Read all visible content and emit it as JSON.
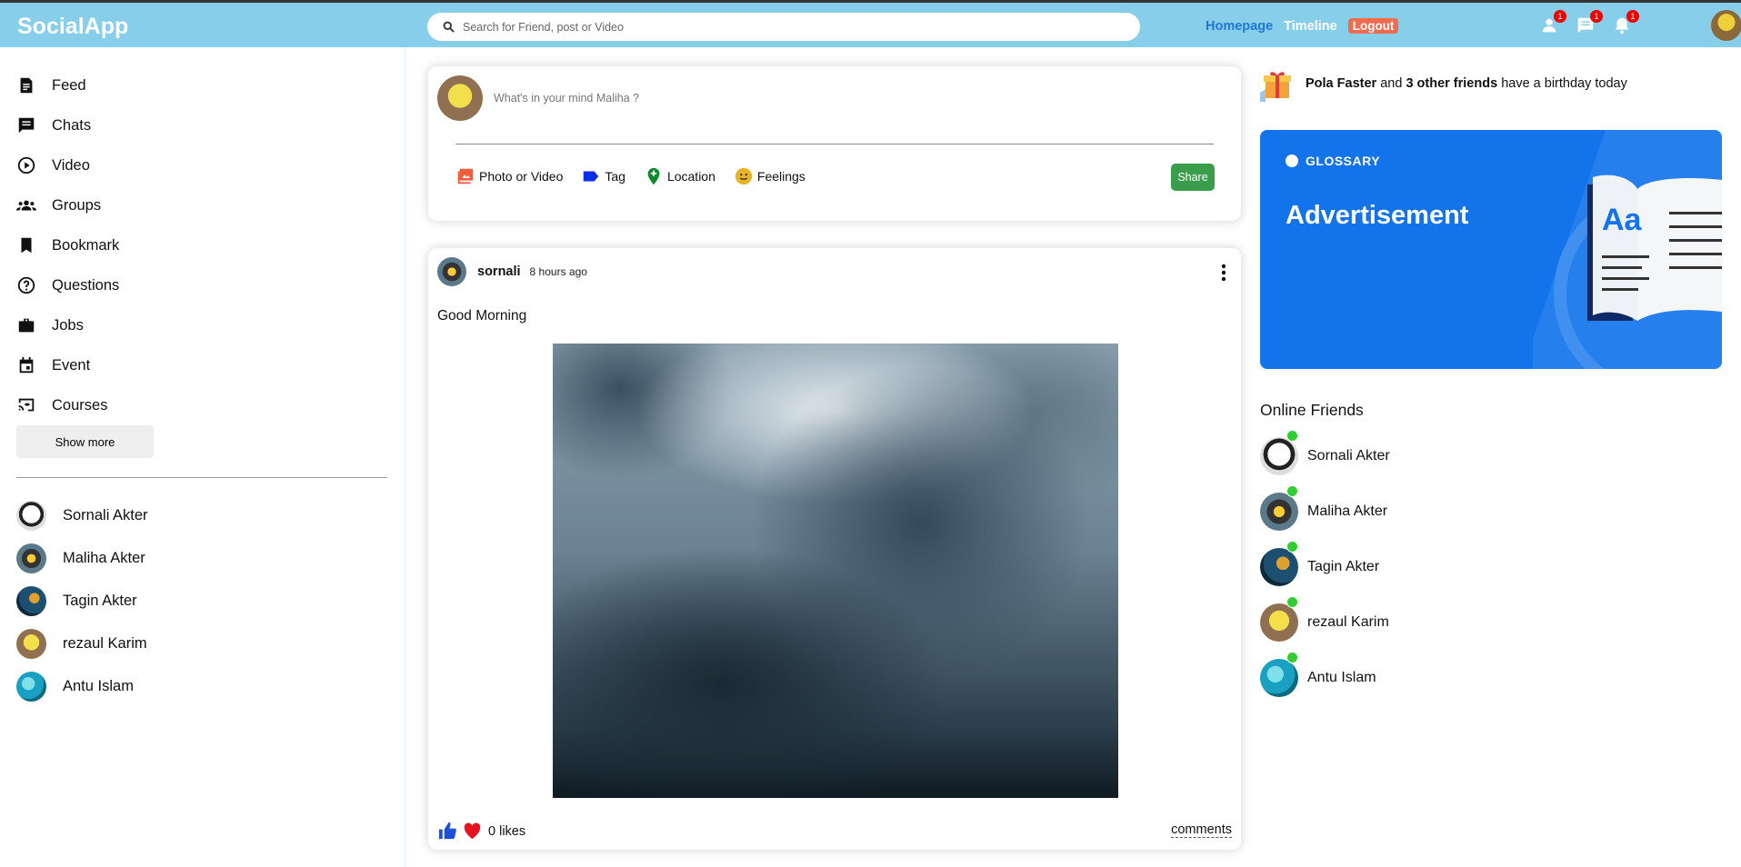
{
  "app": {
    "logo": "SocialApp"
  },
  "search": {
    "placeholder": "Search for Friend, post or Video"
  },
  "top_links": {
    "homepage": "Homepage",
    "timeline": "Timeline",
    "logout": "Logout"
  },
  "notifications": {
    "friends_count": "1",
    "messages_count": "1",
    "alerts_count": "1"
  },
  "sidebar": {
    "items": [
      {
        "label": "Feed",
        "icon": "feed-icon"
      },
      {
        "label": "Chats",
        "icon": "chat-icon"
      },
      {
        "label": "Video",
        "icon": "play-circle-icon"
      },
      {
        "label": "Groups",
        "icon": "groups-icon"
      },
      {
        "label": "Bookmark",
        "icon": "bookmark-icon"
      },
      {
        "label": "Questions",
        "icon": "help-circle-icon"
      },
      {
        "label": "Jobs",
        "icon": "briefcase-icon"
      },
      {
        "label": "Event",
        "icon": "calendar-icon"
      },
      {
        "label": "Courses",
        "icon": "cast-for-education-icon"
      }
    ],
    "show_more": "Show more",
    "friends": [
      "Sornali Akter",
      "Maliha Akter",
      "Tagin Akter",
      "rezaul Karim",
      "Antu Islam"
    ]
  },
  "composer": {
    "placeholder": "What's in your mind Maliha ?",
    "options": {
      "photo": "Photo or Video",
      "tag": "Tag",
      "location": "Location",
      "feelings": "Feelings"
    },
    "share": "Share"
  },
  "post": {
    "username": "sornali",
    "time": "8 hours ago",
    "text": "Good Morning",
    "likes": "0 likes",
    "comments": "comments"
  },
  "birthday": {
    "name": "Pola Faster",
    "others": "3 other friends",
    "suffix": "have a birthday today",
    "and": "and"
  },
  "ad": {
    "brand": "GLOSSARY",
    "title": "Advertisement",
    "book_text": "Aa"
  },
  "online": {
    "title": "Online Friends",
    "friends": [
      "Sornali Akter",
      "Maliha Akter",
      "Tagin Akter",
      "rezaul Karim",
      "Antu Islam"
    ]
  },
  "colors": {
    "topbar": "#87ceeb",
    "active_link": "#1f77d6",
    "logout": "#f26b4f",
    "share": "#3a9d4b",
    "ad": "#1273eb",
    "online_dot": "#32cd32"
  }
}
